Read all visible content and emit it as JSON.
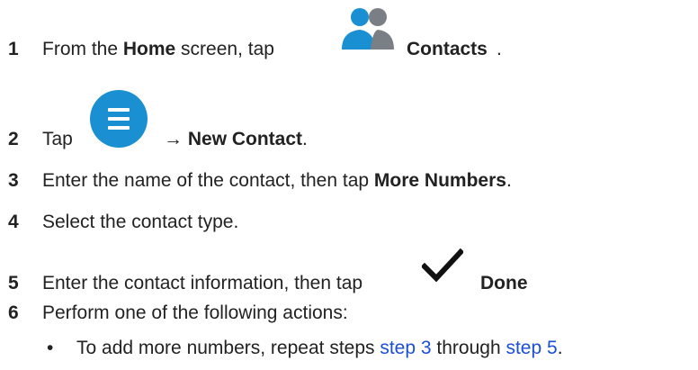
{
  "steps": [
    {
      "num": "1",
      "pre": "From the ",
      "b1": "Home",
      "mid": " screen, tap ",
      "b2": "Contacts",
      "post": "."
    },
    {
      "num": "2",
      "pre": "Tap ",
      "arrow": "→ ",
      "b1": "New Contact",
      "post": "."
    },
    {
      "num": "3",
      "pre": "Enter the name of the contact, then tap ",
      "b1": "More Numbers",
      "post": "."
    },
    {
      "num": "4",
      "pre": "Select the contact type."
    },
    {
      "num": "5",
      "pre": "Enter the contact information, then tap ",
      "b1": "Done"
    },
    {
      "num": "6",
      "pre": "Perform one of the following actions:"
    }
  ],
  "bullet": {
    "mark": "•",
    "pre": "To add more numbers, repeat steps ",
    "link1": "step 3",
    "mid": " through ",
    "link2": "step 5",
    "post": "."
  },
  "icons": {
    "contacts": "contacts-icon",
    "menu": "menu-icon",
    "done": "checkmark-icon",
    "accent": "#1a8fd1"
  }
}
